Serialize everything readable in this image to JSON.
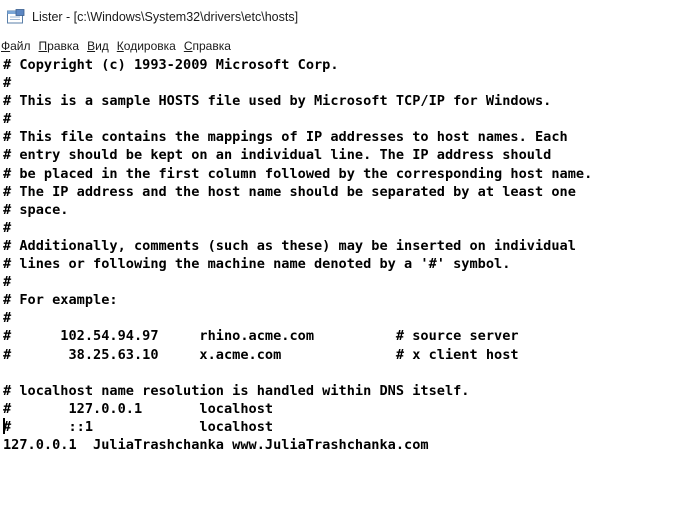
{
  "window": {
    "title": "Lister - [c:\\Windows\\System32\\drivers\\etc\\hosts]",
    "icon": "lister-app-icon"
  },
  "menu": [
    {
      "hotkey": "Ф",
      "rest": "айл"
    },
    {
      "hotkey": "П",
      "rest": "равка"
    },
    {
      "hotkey": "В",
      "rest": "ид"
    },
    {
      "hotkey": "К",
      "rest": "одировка"
    },
    {
      "hotkey": "С",
      "rest": "правка"
    }
  ],
  "file_lines": [
    "# Copyright (c) 1993-2009 Microsoft Corp.",
    "#",
    "# This is a sample HOSTS file used by Microsoft TCP/IP for Windows.",
    "#",
    "# This file contains the mappings of IP addresses to host names. Each",
    "# entry should be kept on an individual line. The IP address should",
    "# be placed in the first column followed by the corresponding host name.",
    "# The IP address and the host name should be separated by at least one",
    "# space.",
    "#",
    "# Additionally, comments (such as these) may be inserted on individual",
    "# lines or following the machine name denoted by a '#' symbol.",
    "#",
    "# For example:",
    "#",
    "#      102.54.94.97     rhino.acme.com          # source server",
    "#       38.25.63.10     x.acme.com              # x client host",
    "",
    "# localhost name resolution is handled within DNS itself.",
    "#       127.0.0.1       localhost",
    "#       ::1             localhost",
    "127.0.0.1  JuliaTrashchanka www.JuliaTrashchanka.com"
  ]
}
